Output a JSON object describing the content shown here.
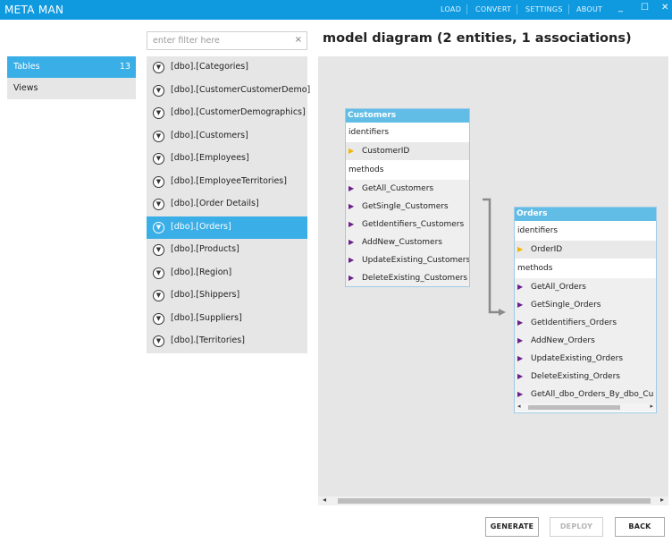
{
  "app": {
    "title": "META MAN"
  },
  "menu": {
    "items": [
      "LOAD",
      "CONVERT",
      "SETTINGS",
      "ABOUT"
    ]
  },
  "window": {
    "minimize": "_",
    "maximize": "☐",
    "close": "✕"
  },
  "nav": {
    "items": [
      {
        "label": "Tables",
        "count": "13",
        "active": true
      },
      {
        "label": "Views",
        "count": "",
        "active": false
      }
    ]
  },
  "filter": {
    "placeholder": "enter filter here",
    "value": "",
    "clear_icon": "×"
  },
  "tables": {
    "items": [
      "[dbo].[Categories]",
      "[dbo].[CustomerCustomerDemo]",
      "[dbo].[CustomerDemographics]",
      "[dbo].[Customers]",
      "[dbo].[Employees]",
      "[dbo].[EmployeeTerritories]",
      "[dbo].[Order Details]",
      "[dbo].[Orders]",
      "[dbo].[Products]",
      "[dbo].[Region]",
      "[dbo].[Shippers]",
      "[dbo].[Suppliers]",
      "[dbo].[Territories]"
    ],
    "selected": "[dbo].[Orders]",
    "item_icon": "filter-toggle-icon"
  },
  "diagram": {
    "title": "model diagram  (2 entities, 1 associations)",
    "entities": [
      {
        "name": "Customers",
        "identifiers_label": "identifiers",
        "identifiers": [
          "CustomerID"
        ],
        "methods_label": "methods",
        "methods": [
          "GetAll_Customers",
          "GetSingle_Customers",
          "GetIdentifiers_Customers",
          "AddNew_Customers",
          "UpdateExisting_Customers",
          "DeleteExisting_Customers"
        ]
      },
      {
        "name": "Orders",
        "identifiers_label": "identifiers",
        "identifiers": [
          "OrderID"
        ],
        "methods_label": "methods",
        "methods": [
          "GetAll_Orders",
          "GetSingle_Orders",
          "GetIdentifiers_Orders",
          "AddNew_Orders",
          "UpdateExisting_Orders",
          "DeleteExisting_Orders",
          "GetAll_dbo_Orders_By_dbo_Cu"
        ]
      }
    ]
  },
  "footer": {
    "generate": "GENERATE",
    "deploy": "DEPLOY",
    "back": "BACK"
  },
  "colors": {
    "accent": "#0f9ae0",
    "selected": "#3aaee6",
    "entity_header": "#61bde6",
    "key_arrow": "#f2b600",
    "method_arrow": "#6a1f8a"
  }
}
